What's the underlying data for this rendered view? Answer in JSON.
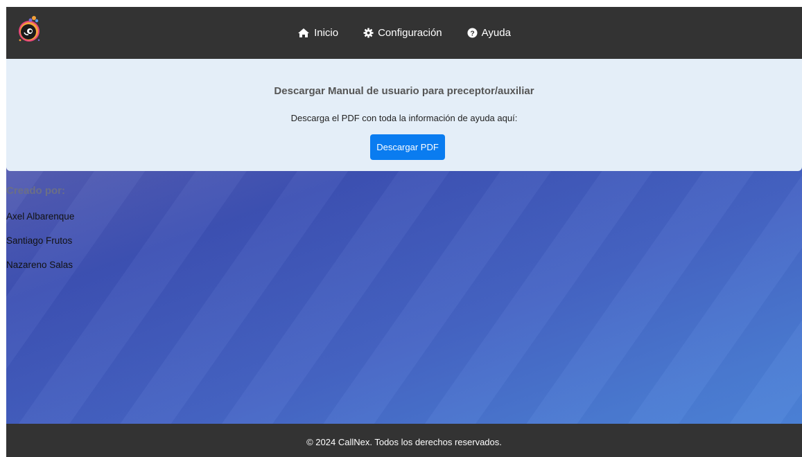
{
  "nav": {
    "logo_icon": "eye-ball-logo",
    "links": [
      {
        "label": "Inicio",
        "icon": "home-icon"
      },
      {
        "label": "Configuración",
        "icon": "gear-icon"
      },
      {
        "label": "Ayuda",
        "icon": "question-circle-icon"
      }
    ]
  },
  "help": {
    "title": "Descargar Manual de usuario para preceptor/auxiliar",
    "text": "Descarga el PDF con toda la información de ayuda aquí:",
    "button_label": "Descargar PDF"
  },
  "credits": {
    "title": "Creado por:",
    "names": [
      "Axel Albarenque",
      "Santiago Frutos",
      "Nazareno Salas"
    ]
  },
  "footer": {
    "text": "© 2024 CallNex. Todos los derechos reservados."
  },
  "colors": {
    "navbar": "#333333",
    "help_card": "#e4eef8",
    "button": "#0a7cf0",
    "footer": "#333333"
  }
}
